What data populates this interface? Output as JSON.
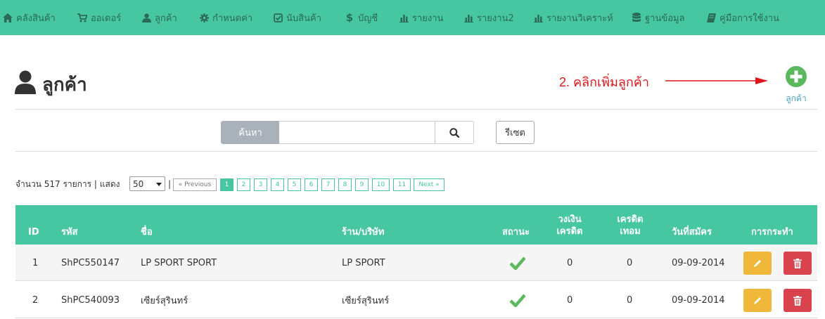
{
  "nav": {
    "items": [
      {
        "label": "คลังสินค้า",
        "icon": "home-icon"
      },
      {
        "label": "ออเดอร์",
        "icon": "cart-icon"
      },
      {
        "label": "ลูกค้า",
        "icon": "user-icon"
      },
      {
        "label": "กำหนดค่า",
        "icon": "gear-icon"
      },
      {
        "label": "นับสินค้า",
        "icon": "check-square-icon"
      },
      {
        "label": "บัญชี",
        "icon": "dollar-icon"
      },
      {
        "label": "รายงาน",
        "icon": "bar-chart-icon"
      },
      {
        "label": "รายงาน2",
        "icon": "bar-chart-icon"
      },
      {
        "label": "รายงานวิเคราะห์",
        "icon": "bar-chart-icon"
      },
      {
        "label": "ฐานข้อมูล",
        "icon": "database-icon"
      },
      {
        "label": "คู่มือการใช้งาน",
        "icon": "book-icon"
      }
    ]
  },
  "page": {
    "title": "ลูกค้า",
    "annotation": "2. คลิกเพิ่มลูกค้า",
    "add_label": "ลูกค้า"
  },
  "search": {
    "label": "ค้นหา",
    "value": "",
    "reset_label": "รีเซต"
  },
  "listing": {
    "count_text": "จำนวน 517 รายการ | แสดง",
    "page_size": "50",
    "separator": "|",
    "prev_label": "« Previous",
    "next_label": "Next »",
    "pages": [
      "1",
      "2",
      "3",
      "4",
      "5",
      "6",
      "7",
      "8",
      "9",
      "10",
      "11"
    ],
    "current_page": "1"
  },
  "table": {
    "headers": {
      "id": "ID",
      "code": "รหัส",
      "name": "ชื่อ",
      "shop": "ร้าน/บริษัท",
      "status": "สถานะ",
      "credit_limit_1": "วงเงิน",
      "credit_limit_2": "เครดิต",
      "credit_grace_1": "เครดิต",
      "credit_grace_2": "เทอม",
      "registered": "วันที่สมัคร",
      "actions": "การกระทำ"
    },
    "rows": [
      {
        "id": "1",
        "code": "ShPC550147",
        "name": "LP SPORT SPORT",
        "shop": "LP SPORT",
        "status": "active",
        "credit_limit": "0",
        "credit_term": "0",
        "registered": "09-09-2014"
      },
      {
        "id": "2",
        "code": "ShPC540093",
        "name": "เซียร์สุรินทร์",
        "shop": "เซียร์สุรินทร์",
        "status": "active",
        "credit_limit": "0",
        "credit_term": "0",
        "registered": "09-09-2014"
      }
    ]
  },
  "colors": {
    "brand": "#47c6a2",
    "annotation": "#e0151b",
    "edit": "#f0b83a",
    "delete": "#d9434e",
    "add": "#5cb85c"
  }
}
